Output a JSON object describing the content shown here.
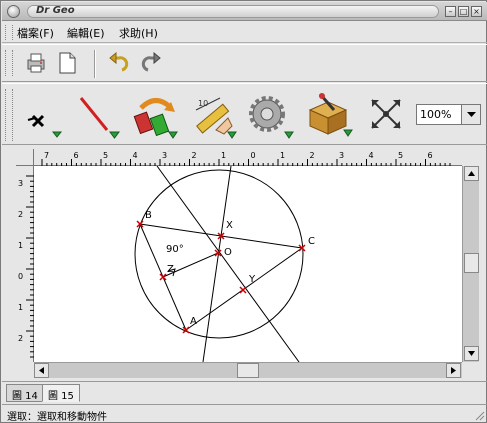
{
  "window": {
    "title": "Dr Geo"
  },
  "menu": [
    {
      "label": "檔案(F)"
    },
    {
      "label": "編輯(E)"
    },
    {
      "label": "求助(H)"
    }
  ],
  "toolbar1": [
    {
      "name": "print-icon"
    },
    {
      "name": "new-document-icon"
    },
    {
      "name": "undo-icon"
    },
    {
      "name": "redo-icon"
    }
  ],
  "toolbar2": [
    {
      "name": "point-tool-icon"
    },
    {
      "name": "line-tool-icon"
    },
    {
      "name": "transformation-tool-icon"
    },
    {
      "name": "measure-tool-icon"
    },
    {
      "name": "macro-gear-icon"
    },
    {
      "name": "misc-box-icon"
    },
    {
      "name": "move-cross-icon"
    }
  ],
  "zoom": {
    "value": "100%"
  },
  "rulers": {
    "h_labels": [
      "7",
      "6",
      "5",
      "4",
      "3",
      "2",
      "1",
      "0",
      "1",
      "2",
      "3",
      "4",
      "5",
      "6"
    ],
    "v_labels": [
      "3",
      "2",
      "1",
      "0",
      "1",
      "2"
    ]
  },
  "geometry": {
    "points": [
      {
        "label": "B"
      },
      {
        "label": "C"
      },
      {
        "label": "A"
      },
      {
        "label": "X"
      },
      {
        "label": "O"
      },
      {
        "label": "Y"
      },
      {
        "label": "Z"
      }
    ],
    "angle_label": "90°"
  },
  "tabs": [
    {
      "label": "圖 14",
      "active": false
    },
    {
      "label": "圖 15",
      "active": true
    }
  ],
  "status": {
    "text": "選取：選取和移動物件"
  },
  "colors": {
    "point": "#cc0000",
    "line": "#000000",
    "canvas": "#ffffff"
  }
}
